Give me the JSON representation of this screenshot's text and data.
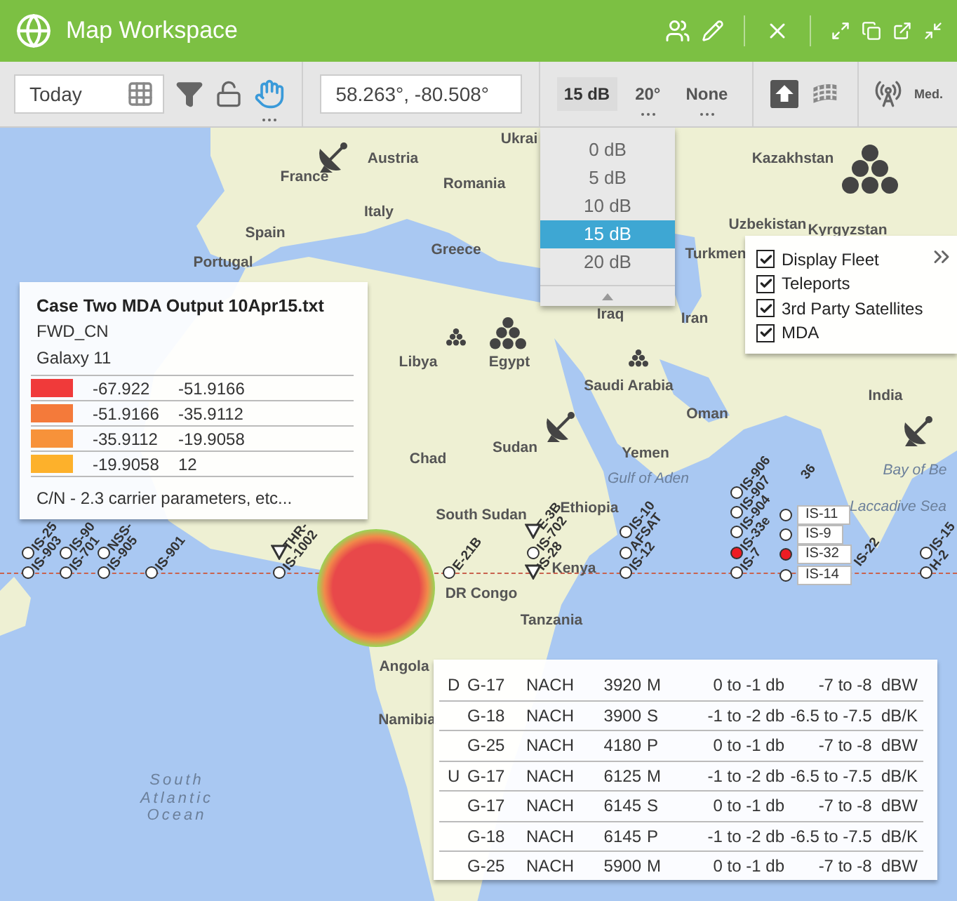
{
  "window": {
    "title": "Map Workspace"
  },
  "toolbar": {
    "date": "Today",
    "coordinates": "58.263°, -80.508°",
    "gain": {
      "label": "15 dB",
      "expanded": true,
      "options": [
        {
          "label": "0 dB",
          "selected": false
        },
        {
          "label": "5 dB",
          "selected": false
        },
        {
          "label": "10 dB",
          "selected": false
        },
        {
          "label": "15 dB",
          "selected": true
        },
        {
          "label": "20 dB",
          "selected": false
        }
      ]
    },
    "elevation": "20°",
    "overlay": "None",
    "signal": "Med."
  },
  "map": {
    "places": [
      {
        "label": "Ukrai",
        "kind": "country"
      },
      {
        "label": "Austria",
        "kind": "country"
      },
      {
        "label": "France",
        "kind": "country"
      },
      {
        "label": "Romania",
        "kind": "country"
      },
      {
        "label": "Italy",
        "kind": "country"
      },
      {
        "label": "Spain",
        "kind": "country"
      },
      {
        "label": "Portugal",
        "kind": "country"
      },
      {
        "label": "Greece",
        "kind": "country"
      },
      {
        "label": "Kazakhstan",
        "kind": "country"
      },
      {
        "label": "Uzbekistan",
        "kind": "country"
      },
      {
        "label": "Kyrgyzstan",
        "kind": "country"
      },
      {
        "label": "Turkmen",
        "kind": "country"
      },
      {
        "label": "Iraq",
        "kind": "country"
      },
      {
        "label": "Iran",
        "kind": "country"
      },
      {
        "label": "Libya",
        "kind": "country"
      },
      {
        "label": "Egypt",
        "kind": "country"
      },
      {
        "label": "Saudi Arabia",
        "kind": "country"
      },
      {
        "label": "Oman",
        "kind": "country"
      },
      {
        "label": "India",
        "kind": "country"
      },
      {
        "label": "Chad",
        "kind": "country"
      },
      {
        "label": "Sudan",
        "kind": "country"
      },
      {
        "label": "Yemen",
        "kind": "country"
      },
      {
        "label": "Gulf of Aden",
        "kind": "sea"
      },
      {
        "label": "Bay of Be",
        "kind": "sea"
      },
      {
        "label": "South Sudan",
        "kind": "country"
      },
      {
        "label": "Ethiopia",
        "kind": "country"
      },
      {
        "label": "Kenya",
        "kind": "country"
      },
      {
        "label": "DR Congo",
        "kind": "country"
      },
      {
        "label": "Tanzania",
        "kind": "country"
      },
      {
        "label": "Angola",
        "kind": "country"
      },
      {
        "label": "Namibia",
        "kind": "country"
      },
      {
        "label": "South Atlantic Ocean",
        "kind": "ocean"
      },
      {
        "label": "Laccadive Sea",
        "kind": "sea"
      }
    ],
    "satellites": [
      {
        "kind": "circle",
        "label": "IS-25",
        "color": "#ffffff"
      },
      {
        "kind": "circle",
        "label": "IS-903",
        "color": "#ffffff"
      },
      {
        "kind": "circle",
        "label": "IS-90",
        "color": "#ffffff"
      },
      {
        "kind": "circle",
        "label": "IS-701",
        "color": "#ffffff"
      },
      {
        "kind": "circle",
        "label": "NSS-",
        "color": "#ffffff"
      },
      {
        "kind": "circle",
        "label": "IS-905",
        "color": "#ffffff"
      },
      {
        "kind": "circle",
        "label": "IS-901",
        "color": "#ffffff"
      },
      {
        "kind": "triangle",
        "label": "THR-"
      },
      {
        "kind": "circle",
        "label": "IS-1002",
        "color": "#ffffff"
      },
      {
        "kind": "circle",
        "label": "E-21B",
        "color": "#ffffff"
      },
      {
        "kind": "triangle",
        "label": "E-3B"
      },
      {
        "kind": "circle",
        "label": "IS-702",
        "color": "#ffffff"
      },
      {
        "kind": "triangle",
        "label": "IS-28"
      },
      {
        "kind": "circle",
        "label": "IS-10",
        "color": "#ffffff"
      },
      {
        "kind": "circle",
        "label": "AFSAT",
        "color": "#ffffff"
      },
      {
        "kind": "circle",
        "label": "IS-12",
        "color": "#ffffff"
      },
      {
        "kind": "circle",
        "label": "IS-906",
        "color": "#ffffff"
      },
      {
        "kind": "circle",
        "label": "IS-907",
        "color": "#ffffff"
      },
      {
        "kind": "circle",
        "label": "IS-904",
        "color": "#ffffff"
      },
      {
        "kind": "circle",
        "label": "IS-33e",
        "color": "#ee1c24"
      },
      {
        "kind": "circle",
        "label": "IS-7",
        "color": "#ffffff"
      },
      {
        "kind": "label",
        "label": "36"
      },
      {
        "kind": "label",
        "label": "IS-22"
      },
      {
        "kind": "circle",
        "label": "IS-15",
        "color": "#ffffff"
      },
      {
        "kind": "circle",
        "label": "H-2",
        "color": "#ffffff"
      }
    ],
    "callouts": [
      {
        "label": "IS-11",
        "color": "#ffffff"
      },
      {
        "label": "IS-9",
        "color": "#ffffff"
      },
      {
        "label": "IS-32",
        "color": "#ee1c24"
      },
      {
        "label": "IS-14",
        "color": "#ffffff"
      }
    ]
  },
  "legend": {
    "title": "Case Two MDA Output 10Apr15.txt",
    "lines": [
      "FWD_CN",
      "Galaxy 11"
    ],
    "ranges": [
      {
        "min": "-67.922",
        "max": "-51.9166",
        "color": "#f03a3a"
      },
      {
        "min": "-51.9166",
        "max": "-35.9112",
        "color": "#f47a3a"
      },
      {
        "min": "-35.9112",
        "max": "-19.9058",
        "color": "#f7923a"
      },
      {
        "min": "-19.9058",
        "max": "12",
        "color": "#fdb12b"
      }
    ],
    "note": "C/N - 2.3 carrier parameters, etc..."
  },
  "layers": [
    {
      "label": "Display Fleet",
      "checked": true
    },
    {
      "label": "Teleports",
      "checked": true
    },
    {
      "label": "3rd Party Satellites",
      "checked": true
    },
    {
      "label": "MDA",
      "checked": true
    }
  ],
  "table": {
    "rows": [
      {
        "direction": "D",
        "satellite": "G-17",
        "carrier": "NACH",
        "frequency": "3920",
        "polarization": "M",
        "range": "0 to -1 db",
        "power": "-7 to -8  dBW"
      },
      {
        "satellite": "G-18",
        "carrier": "NACH",
        "frequency": "3900",
        "polarization": "S",
        "range": "-1 to -2 db",
        "power": "-6.5 to -7.5  dB/K"
      },
      {
        "satellite": "G-25",
        "carrier": "NACH",
        "frequency": "4180",
        "polarization": "P",
        "range": "0 to -1 db",
        "power": "-7 to -8  dBW"
      },
      {
        "direction": "U",
        "satellite": "G-17",
        "carrier": "NACH",
        "frequency": "6125",
        "polarization": "M",
        "range": "-1 to -2 db",
        "power": "-6.5 to -7.5  dB/K"
      },
      {
        "satellite": "G-17",
        "carrier": "NACH",
        "frequency": "6145",
        "polarization": "S",
        "range": "0 to -1 db",
        "power": "-7 to -8  dBW"
      },
      {
        "satellite": "G-18",
        "carrier": "NACH",
        "frequency": "6145",
        "polarization": "P",
        "range": "-1 to -2 db",
        "power": "-6.5 to -7.5  dB/K"
      },
      {
        "satellite": "G-25",
        "carrier": "NACH",
        "frequency": "5900",
        "polarization": "M",
        "range": "0 to -1 db",
        "power": "-7 to -8  dBW"
      }
    ]
  }
}
